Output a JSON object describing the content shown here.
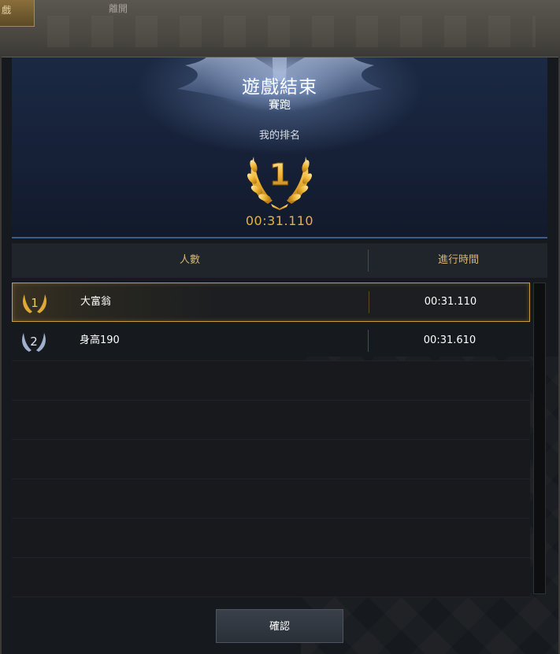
{
  "background": {
    "tab_left_label": "戲",
    "leave_label": "離開"
  },
  "dialog": {
    "title": "遊戲結束",
    "subtitle": "賽跑",
    "my_rank_label": "我的排名",
    "my_rank": "1",
    "my_time": "00:31.110",
    "columns": {
      "players": "人數",
      "time": "進行時間"
    },
    "results": [
      {
        "rank": "1",
        "name": "大富翁",
        "time": "00:31.110"
      },
      {
        "rank": "2",
        "name": "身高190",
        "time": "00:31.610"
      }
    ],
    "confirm_label": "確認"
  },
  "colors": {
    "gold": "#e5b440",
    "highlight_border": "#c99a3e",
    "header_blue": "#1b2943",
    "silver": "#9fb0cc"
  },
  "icons": {
    "gold_laurel": "laurel-gold-icon",
    "silver_laurel": "laurel-silver-icon",
    "wings": "winged-crest-icon"
  }
}
